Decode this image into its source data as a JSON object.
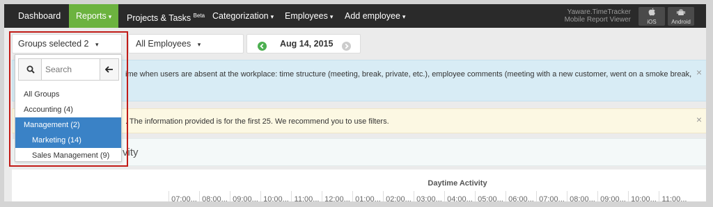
{
  "nav": {
    "items": [
      {
        "label": "Dashboard",
        "active": false
      },
      {
        "label": "Reports",
        "active": true
      },
      {
        "label": "Projects & Tasks",
        "active": false
      },
      {
        "label": "Categorization",
        "active": false
      },
      {
        "label": "Employees",
        "active": false
      },
      {
        "label": "Add employee",
        "active": false
      }
    ],
    "beta": "Beta",
    "mobile_line1": "Yaware.TimeTracker",
    "mobile_line2": "Mobile Report Viewer",
    "ios_label": "iOS",
    "android_label": "Android"
  },
  "toolbar": {
    "groups_label": "Groups selected 2",
    "employees_label": "All Employees",
    "date_label": "Aug 14, 2015"
  },
  "dropdown": {
    "search_placeholder": "Search",
    "items": [
      {
        "label": "All Groups",
        "selected": false
      },
      {
        "label": "Accounting (4)",
        "selected": false
      },
      {
        "label": "Management (2)",
        "selected": true
      },
      {
        "label": "Marketing (14)",
        "selected": true
      },
      {
        "label": "Sales Management (9)",
        "selected": false
      }
    ]
  },
  "alerts": {
    "info_text": "ime when users are absent at the workplace: time structure (meeting, break, private, etc.), employee comments (meeting with a new customer, went on a smoke break,",
    "warn_text": ". The information provided is for the first 25. We recommend you to use filters."
  },
  "panel": {
    "title": "vity"
  },
  "table": {
    "daytime_title": "Daytime Activity",
    "times": [
      "07:00...",
      "08:00...",
      "09:00...",
      "10:00...",
      "11:00...",
      "12:00...",
      "01:00...",
      "02:00...",
      "03:00...",
      "04:00...",
      "05:00...",
      "06:00...",
      "07:00...",
      "08:00...",
      "09:00...",
      "10:00...",
      "11:00..."
    ]
  },
  "colors": {
    "nav_bg": "#2a2a2a",
    "active_green": "#6cb33f",
    "selection_blue": "#3a82c6",
    "highlight_red": "#c11b17"
  }
}
